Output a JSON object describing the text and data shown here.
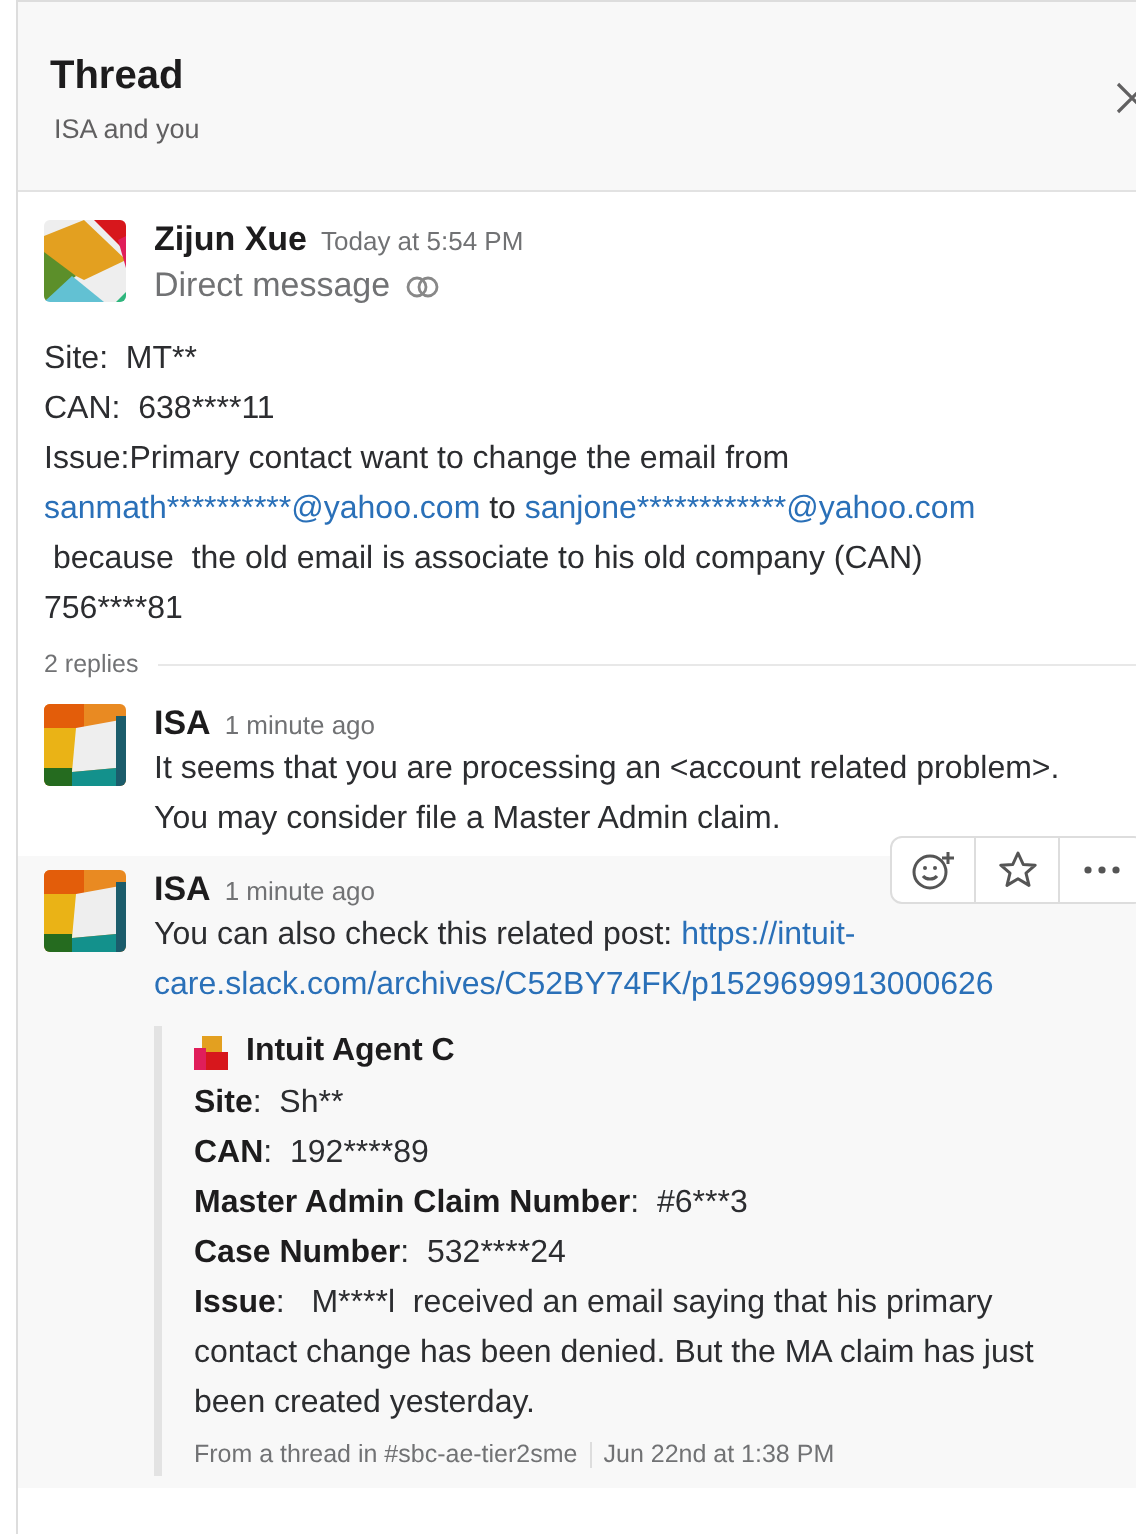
{
  "header": {
    "title": "Thread",
    "subtitle": "ISA and you"
  },
  "parent_message": {
    "author": "Zijun Xue",
    "time": "Today at 5:54 PM",
    "subtitle": "Direct message",
    "lines": [
      [
        {
          "kind": "text",
          "text": "Site:  MT**"
        }
      ],
      [
        {
          "kind": "text",
          "text": "CAN:  638****11"
        }
      ],
      [
        {
          "kind": "text",
          "text": "Issue:Primary contact want to change the email from"
        }
      ],
      [
        {
          "kind": "link",
          "text": "sanmath**********@yahoo.com"
        },
        {
          "kind": "text",
          "text": " to "
        },
        {
          "kind": "link",
          "text": "sanjone************@yahoo.com"
        }
      ],
      [
        {
          "kind": "text",
          "text": " because  the old email is associate to his old company (CAN)"
        }
      ],
      [
        {
          "kind": "text",
          "text": "756****81"
        }
      ]
    ]
  },
  "replies_count": "2 replies",
  "replies": [
    {
      "author": "ISA",
      "time": "1 minute ago",
      "hovered": false,
      "lines": [
        [
          {
            "kind": "text",
            "text": "It seems that you are processing an <account related problem>."
          }
        ],
        [
          {
            "kind": "text",
            "text": "You may consider file a Master Admin claim."
          }
        ]
      ]
    },
    {
      "author": "ISA",
      "time": "1 minute ago",
      "hovered": true,
      "lines": [
        [
          {
            "kind": "text",
            "text": "You can also check this related post: "
          },
          {
            "kind": "link",
            "text": "https://intuit-"
          }
        ],
        [
          {
            "kind": "link",
            "text": "care.slack.com/archives/C52BY74FK/p1529699913000626"
          }
        ]
      ],
      "attachment": {
        "author": "Intuit Agent C",
        "fields": [
          {
            "heading": "Site",
            "rest": ":  Sh**"
          },
          {
            "heading": "CAN",
            "rest": ":  192****89"
          },
          {
            "heading": "Master Admin Claim Number",
            "rest": ":  #6***3"
          },
          {
            "heading": "Case Number",
            "rest": ":  532****24"
          },
          {
            "heading": "Issue",
            "rest": ":   M****l  received an email saying that his primary contact change has been denied. But the MA claim has just been created yesterday."
          }
        ],
        "source": "From a thread in #sbc-ae-tier2sme",
        "date": "Jun 22nd at 1:38 PM"
      }
    }
  ]
}
